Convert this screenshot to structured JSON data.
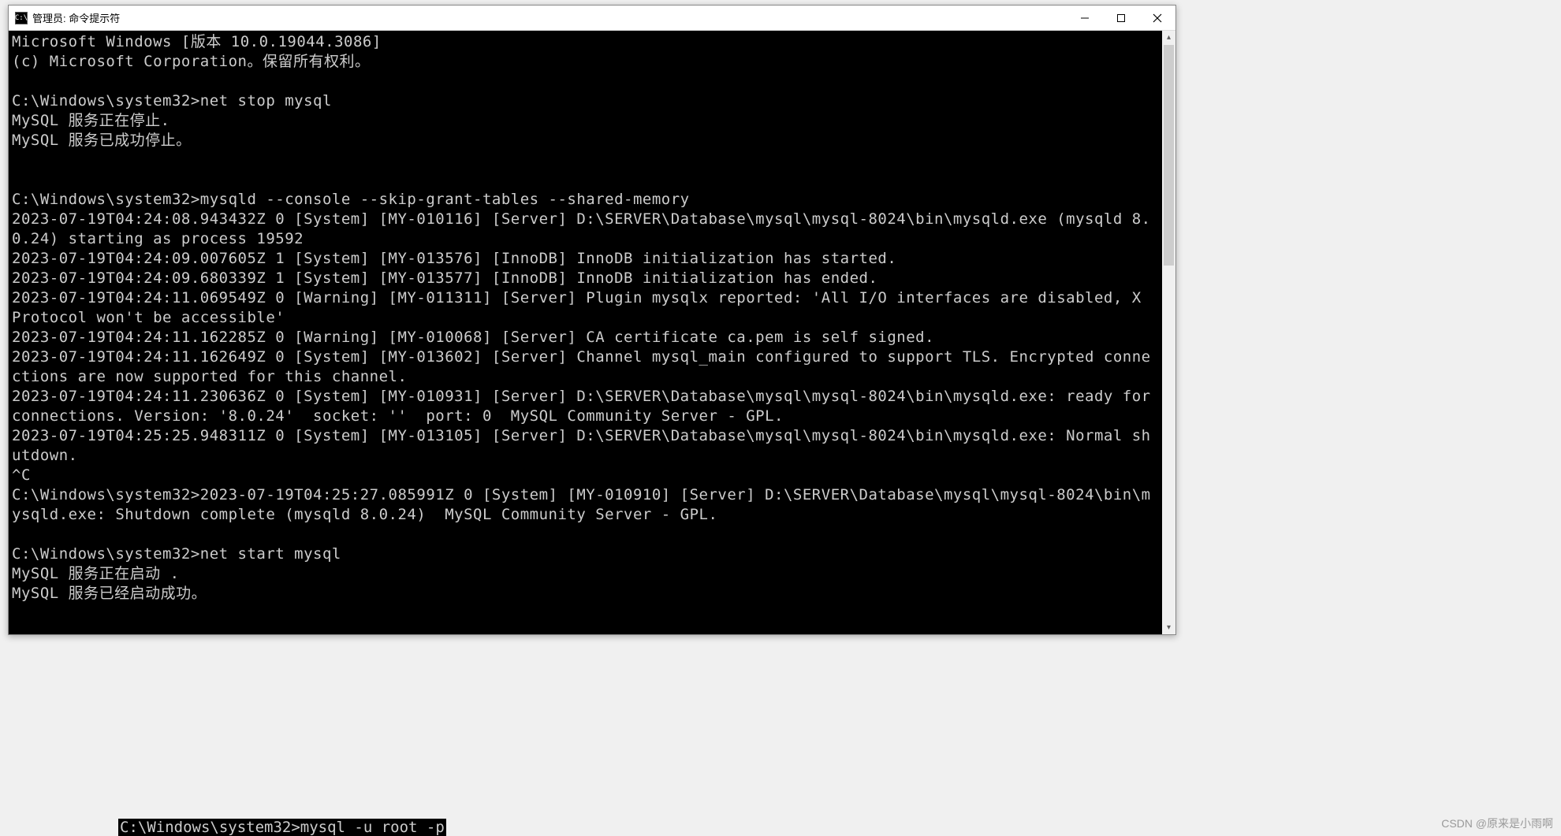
{
  "window": {
    "icon_text": "C:\\",
    "title": "管理员: 命令提示符"
  },
  "terminal": {
    "lines": [
      "Microsoft Windows [版本 10.0.19044.3086]",
      "(c) Microsoft Corporation。保留所有权利。",
      "",
      "C:\\Windows\\system32>net stop mysql",
      "MySQL 服务正在停止.",
      "MySQL 服务已成功停止。",
      "",
      "",
      "C:\\Windows\\system32>mysqld --console --skip-grant-tables --shared-memory",
      "2023-07-19T04:24:08.943432Z 0 [System] [MY-010116] [Server] D:\\SERVER\\Database\\mysql\\mysql-8024\\bin\\mysqld.exe (mysqld 8.0.24) starting as process 19592",
      "2023-07-19T04:24:09.007605Z 1 [System] [MY-013576] [InnoDB] InnoDB initialization has started.",
      "2023-07-19T04:24:09.680339Z 1 [System] [MY-013577] [InnoDB] InnoDB initialization has ended.",
      "2023-07-19T04:24:11.069549Z 0 [Warning] [MY-011311] [Server] Plugin mysqlx reported: 'All I/O interfaces are disabled, X Protocol won't be accessible'",
      "2023-07-19T04:24:11.162285Z 0 [Warning] [MY-010068] [Server] CA certificate ca.pem is self signed.",
      "2023-07-19T04:24:11.162649Z 0 [System] [MY-013602] [Server] Channel mysql_main configured to support TLS. Encrypted connections are now supported for this channel.",
      "2023-07-19T04:24:11.230636Z 0 [System] [MY-010931] [Server] D:\\SERVER\\Database\\mysql\\mysql-8024\\bin\\mysqld.exe: ready for connections. Version: '8.0.24'  socket: ''  port: 0  MySQL Community Server - GPL.",
      "2023-07-19T04:25:25.948311Z 0 [System] [MY-013105] [Server] D:\\SERVER\\Database\\mysql\\mysql-8024\\bin\\mysqld.exe: Normal shutdown.",
      "^C",
      "C:\\Windows\\system32>2023-07-19T04:25:27.085991Z 0 [System] [MY-010910] [Server] D:\\SERVER\\Database\\mysql\\mysql-8024\\bin\\mysqld.exe: Shutdown complete (mysqld 8.0.24)  MySQL Community Server - GPL.",
      "",
      "C:\\Windows\\system32>net start mysql",
      "MySQL 服务正在启动 .",
      "MySQL 服务已经启动成功。"
    ]
  },
  "background": {
    "partial_command": "C:\\Windows\\system32>mysql -u root -p"
  },
  "watermark": "CSDN @原来是小雨啊"
}
